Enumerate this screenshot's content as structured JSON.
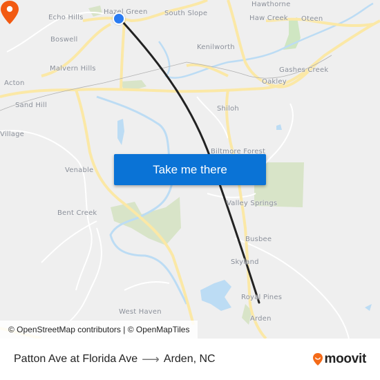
{
  "map": {
    "places": [
      {
        "name": "Hazel Green",
        "label": "Hazel Green"
      },
      {
        "name": "South Slope",
        "label": "South Slope"
      },
      {
        "name": "Echo Hills",
        "label": "Echo Hills"
      },
      {
        "name": "Boswell",
        "label": "Boswell"
      },
      {
        "name": "Malvern Hills",
        "label": "Malvern Hills"
      },
      {
        "name": "Acton",
        "label": "Acton"
      },
      {
        "name": "Sand Hill",
        "label": "Sand Hill"
      },
      {
        "name": "Village",
        "label": "Village"
      },
      {
        "name": "Venable",
        "label": "Venable"
      },
      {
        "name": "Bent Creek",
        "label": "Bent Creek"
      },
      {
        "name": "West Haven",
        "label": "West Haven"
      },
      {
        "name": "Hawthorne",
        "label": "Hawthorne"
      },
      {
        "name": "Haw Creek",
        "label": "Haw Creek"
      },
      {
        "name": "Oteen",
        "label": "Oteen"
      },
      {
        "name": "Kenilworth",
        "label": "Kenilworth"
      },
      {
        "name": "Gashes Creek",
        "label": "Gashes Creek"
      },
      {
        "name": "Oakley",
        "label": "Oakley"
      },
      {
        "name": "Shiloh",
        "label": "Shiloh"
      },
      {
        "name": "Biltmore Forest",
        "label": "Biltmore Forest"
      },
      {
        "name": "Valley Springs",
        "label": "Valley Springs"
      },
      {
        "name": "Busbee",
        "label": "Busbee"
      },
      {
        "name": "Skyland",
        "label": "Skyland"
      },
      {
        "name": "Royal Pines",
        "label": "Royal Pines"
      },
      {
        "name": "Arden",
        "label": "Arden"
      }
    ],
    "cta_label": "Take me there",
    "attribution": "© OpenStreetMap contributors | © OpenMapTiles",
    "origin_marker_color": "#2a7bf2",
    "destination_marker_color": "#f25a12",
    "route_color": "#222222"
  },
  "footer": {
    "origin": "Patton Ave at Florida Ave",
    "arrow": "⟶",
    "destination": "Arden, NC",
    "brand": "moovit",
    "brand_color": "#f46a18"
  }
}
